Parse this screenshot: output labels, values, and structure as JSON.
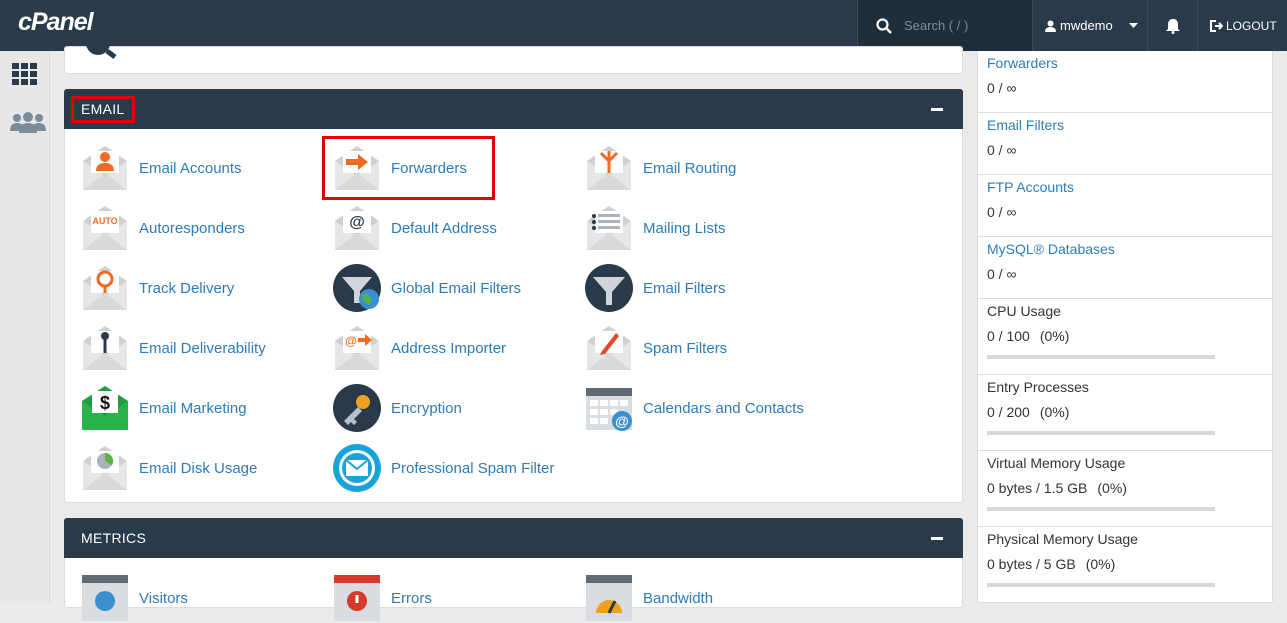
{
  "header": {
    "logo_text": "cPanel",
    "search_placeholder": "Search ( / )",
    "username": "mwdemo",
    "logout_label": "LOGOUT"
  },
  "email_section": {
    "title": "EMAIL",
    "tools": [
      {
        "label": "Email Accounts",
        "icon": "envelope-user-icon"
      },
      {
        "label": "Forwarders",
        "icon": "envelope-forward-icon"
      },
      {
        "label": "Email Routing",
        "icon": "envelope-routing-icon"
      },
      {
        "label": "Autoresponders",
        "icon": "envelope-auto-icon"
      },
      {
        "label": "Default Address",
        "icon": "envelope-at-icon"
      },
      {
        "label": "Mailing Lists",
        "icon": "envelope-list-icon"
      },
      {
        "label": "Track Delivery",
        "icon": "envelope-pin-icon"
      },
      {
        "label": "Global Email Filters",
        "icon": "globe-filter-icon"
      },
      {
        "label": "Email Filters",
        "icon": "filter-icon"
      },
      {
        "label": "Email Deliverability",
        "icon": "envelope-key-icon"
      },
      {
        "label": "Address Importer",
        "icon": "envelope-import-icon"
      },
      {
        "label": "Spam Filters",
        "icon": "envelope-pen-icon"
      },
      {
        "label": "Email Marketing",
        "icon": "envelope-dollar-icon"
      },
      {
        "label": "Encryption",
        "icon": "key-icon"
      },
      {
        "label": "Calendars and Contacts",
        "icon": "calendar-icon"
      },
      {
        "label": "Email Disk Usage",
        "icon": "envelope-pie-icon"
      },
      {
        "label": "Professional Spam Filter",
        "icon": "shield-envelope-icon"
      }
    ]
  },
  "metrics_section": {
    "title": "METRICS",
    "tools": [
      {
        "label": "Visitors",
        "icon": "visitors-icon"
      },
      {
        "label": "Errors",
        "icon": "errors-icon"
      },
      {
        "label": "Bandwidth",
        "icon": "bandwidth-icon"
      }
    ]
  },
  "stats": [
    {
      "label": "Forwarders",
      "value": "0 / ∞",
      "link": true
    },
    {
      "label": "Email Filters",
      "value": "0 / ∞",
      "link": true
    },
    {
      "label": "FTP Accounts",
      "value": "0 / ∞",
      "link": true
    },
    {
      "label": "MySQL® Databases",
      "value": "0 / ∞",
      "link": true
    },
    {
      "label": "CPU Usage",
      "value": "0 / 100",
      "pct": "(0%)",
      "fill": 0
    },
    {
      "label": "Entry Processes",
      "value": "0 / 200",
      "pct": "(0%)",
      "fill": 0
    },
    {
      "label": "Virtual Memory Usage",
      "value": "0 bytes / 1.5 GB",
      "pct": "(0%)",
      "fill": 0
    },
    {
      "label": "Physical Memory Usage",
      "value": "0 bytes / 5 GB",
      "pct": "(0%)",
      "fill": 0
    }
  ],
  "colors": {
    "header": "#293a4a",
    "link": "#2d7bb8",
    "highlight": "#e00000"
  }
}
